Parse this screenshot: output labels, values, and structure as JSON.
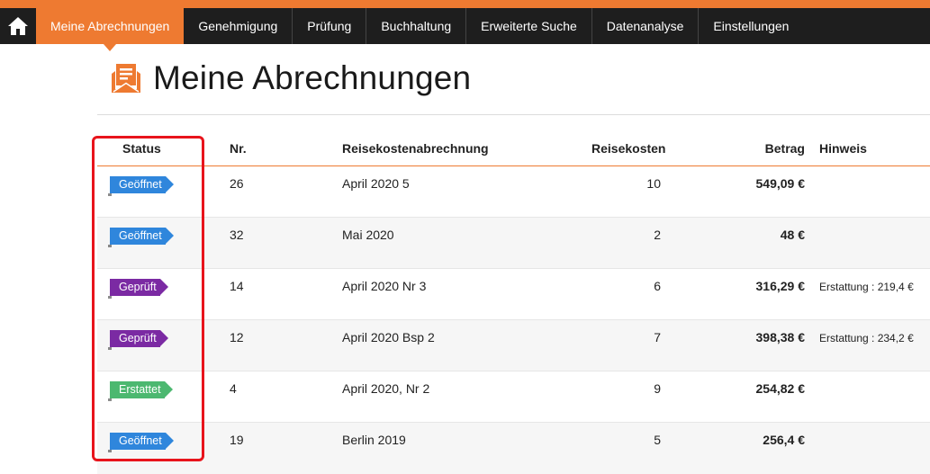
{
  "nav": {
    "home_icon": "home-icon",
    "items": [
      {
        "label": "Meine Abrechnungen",
        "active": true
      },
      {
        "label": "Genehmigung"
      },
      {
        "label": "Prüfung"
      },
      {
        "label": "Buchhaltung"
      },
      {
        "label": "Erweiterte Suche"
      },
      {
        "label": "Datenanalyse"
      },
      {
        "label": "Einstellungen"
      }
    ]
  },
  "page": {
    "title": "Meine Abrechnungen",
    "title_icon": "envelope-receipt-icon"
  },
  "table": {
    "headers": {
      "status": "Status",
      "nr": "Nr.",
      "report": "Reisekostenabrechnung",
      "expenses": "Reisekosten",
      "amount": "Betrag",
      "note": "Hinweis"
    },
    "rows": [
      {
        "status": "Geöffnet",
        "nr": "26",
        "report": "April 2020 5",
        "expenses": "10",
        "amount": "549,09 €",
        "note": ""
      },
      {
        "status": "Geöffnet",
        "nr": "32",
        "report": "Mai 2020",
        "expenses": "2",
        "amount": "48 €",
        "note": ""
      },
      {
        "status": "Geprüft",
        "nr": "14",
        "report": "April 2020 Nr 3",
        "expenses": "6",
        "amount": "316,29 €",
        "note": "Erstattung : 219,4 €"
      },
      {
        "status": "Geprüft",
        "nr": "12",
        "report": "April 2020 Bsp 2",
        "expenses": "7",
        "amount": "398,38 €",
        "note": "Erstattung : 234,2 €"
      },
      {
        "status": "Erstattet",
        "nr": "4",
        "report": "April 2020, Nr 2",
        "expenses": "9",
        "amount": "254,82 €",
        "note": ""
      },
      {
        "status": "Geöffnet",
        "nr": "19",
        "report": "Berlin 2019",
        "expenses": "5",
        "amount": "256,4 €",
        "note": ""
      }
    ]
  },
  "colors": {
    "accent": "#ee7a31",
    "navbar": "#1e1e1e",
    "status_open": "#2f86dc",
    "status_checked": "#7b2aa3",
    "status_refunded": "#4cb870",
    "highlight": "#e8141c"
  }
}
